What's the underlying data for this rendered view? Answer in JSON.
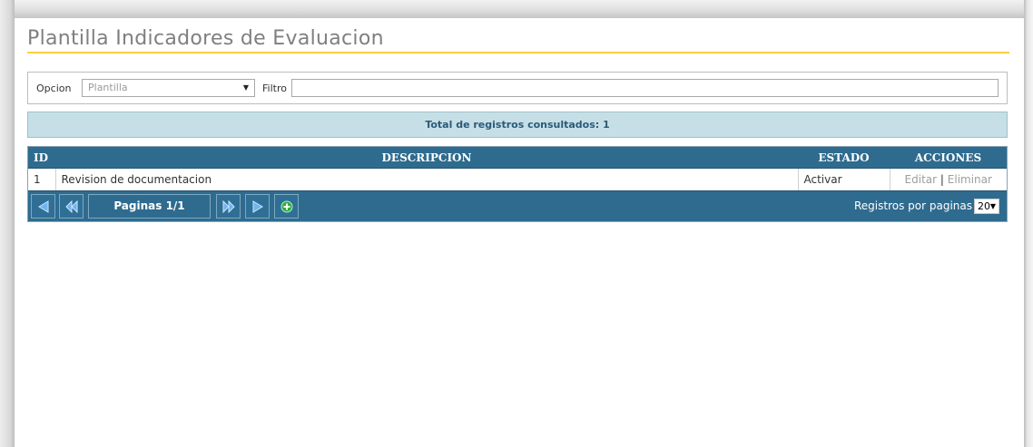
{
  "page": {
    "title": "Plantilla Indicadores de Evaluacion"
  },
  "filter": {
    "opcion_label": "Opcion",
    "opcion_value": "Plantilla",
    "filtro_label": "Filtro",
    "filtro_value": ""
  },
  "summary": {
    "text": "Total de registros consultados: 1"
  },
  "table": {
    "columns": [
      "ID",
      "DESCRIPCION",
      "ESTADO",
      "ACCIONES"
    ],
    "rows": [
      {
        "id": "1",
        "descripcion": "Revision de documentacion",
        "estado": "Activar",
        "editar": "Editar",
        "separator": "|",
        "eliminar": "Eliminar"
      }
    ]
  },
  "pager": {
    "page_text": "Paginas 1/1",
    "records_label": "Registros por paginas",
    "records_per_page": "20"
  },
  "colors": {
    "header_bg": "#2e6b8f",
    "summary_bg": "#c6dfe6",
    "title_rule": "#f5d046",
    "add_icon": "#2fae47"
  }
}
